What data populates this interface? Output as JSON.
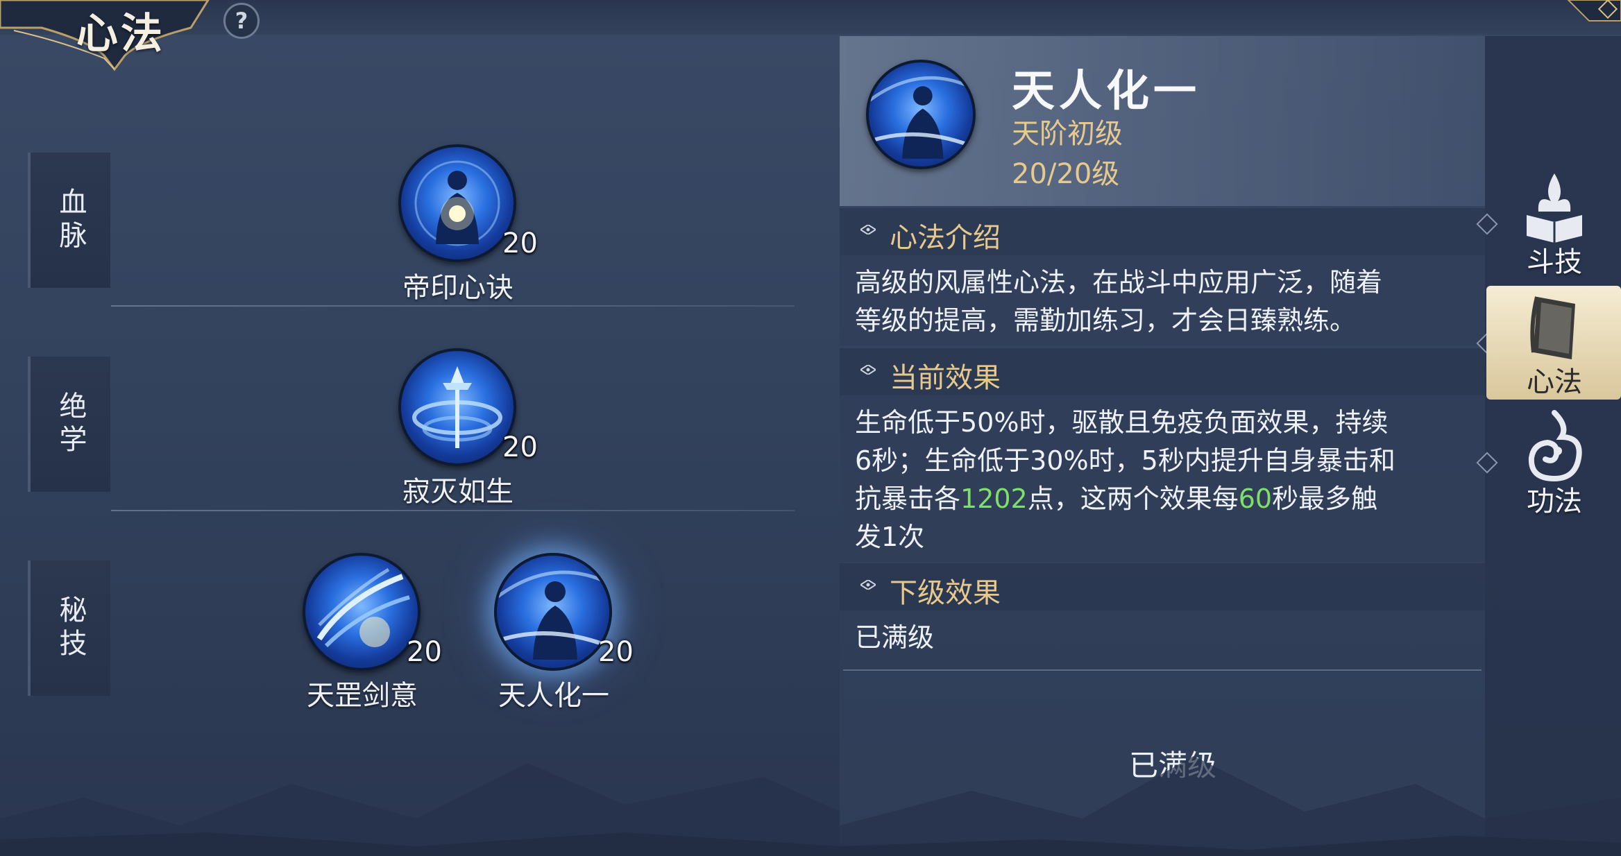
{
  "header": {
    "title": "心法",
    "help_label": "?"
  },
  "categories": [
    {
      "label": "血脉"
    },
    {
      "label": "绝学"
    },
    {
      "label": "秘技"
    }
  ],
  "skills": [
    {
      "name": "帝印心诀",
      "level": "20"
    },
    {
      "name": "寂灭如生",
      "level": "20"
    },
    {
      "name": "天罡剑意",
      "level": "20"
    },
    {
      "name": "天人化一",
      "level": "20",
      "selected": true
    }
  ],
  "detail": {
    "title": "天人化一",
    "tier": "天阶初级",
    "progress": "20/20级",
    "intro_title": "心法介绍",
    "intro_text_1": "高级的风属性心法，在战斗中应用广泛，随着",
    "intro_text_2": "等级的提高，需勤加练习，才会日臻熟练。",
    "current_title": "当前效果",
    "current_line_1": "生命低于50%时，驱散且免疫负面效果，持续",
    "current_line_2": "6秒；生命低于30%时，5秒内提升自身暴击和",
    "current_line_3_a": "抗暴击各",
    "current_line_3_v1": "1202",
    "current_line_3_b": "点，这两个效果每",
    "current_line_3_v2": "60",
    "current_line_3_c": "秒最多触",
    "current_line_4": "发1次",
    "next_title": "下级效果",
    "next_text": "已满级",
    "bottom_status": "已满级"
  },
  "nav": [
    {
      "label": "斗技",
      "icon": "flame-book-icon"
    },
    {
      "label": "心法",
      "icon": "book-icon",
      "active": true
    },
    {
      "label": "功法",
      "icon": "swirl-flame-icon"
    }
  ],
  "colors": {
    "gold_text": "#e7c98d",
    "highlight_green": "#7ee06a",
    "active_tab": "#f5ecd4"
  }
}
